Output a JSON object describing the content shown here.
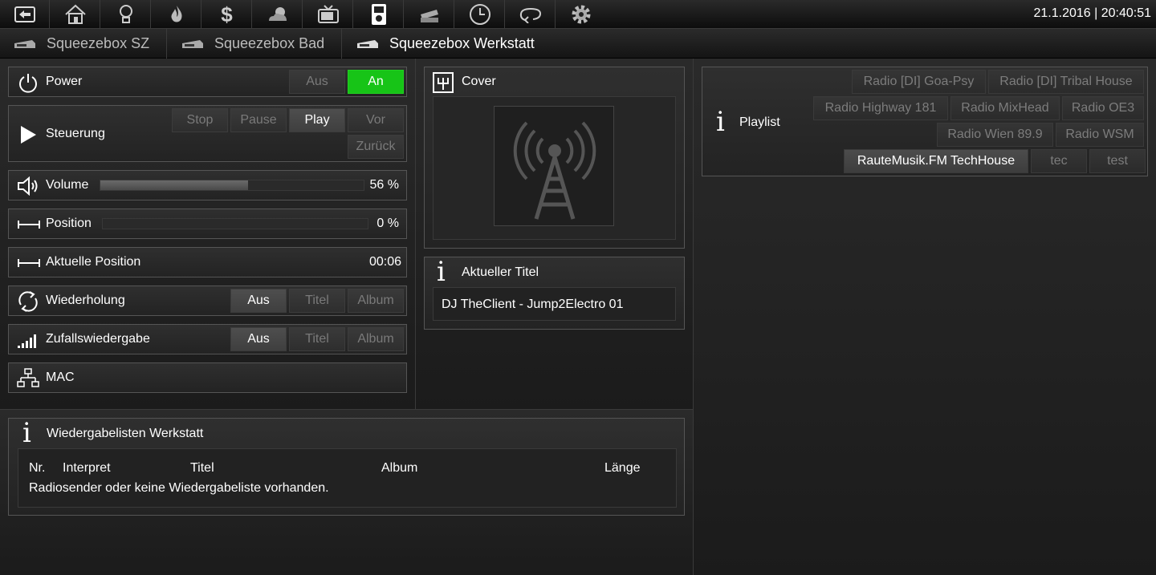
{
  "header": {
    "datetime": "21.1.2016 | 20:40:51",
    "nav_icons": [
      "back-icon",
      "home-icon",
      "bulb-icon",
      "flame-icon",
      "dollar-icon",
      "weather-icon",
      "tv-icon",
      "media-player-icon",
      "scanner-icon",
      "clock-icon",
      "loop-icon",
      "gear-icon"
    ]
  },
  "tabs": [
    "Squeezebox SZ",
    "Squeezebox Bad",
    "Squeezebox Werkstatt"
  ],
  "controls": {
    "power": {
      "label": "Power",
      "off": "Aus",
      "on": "An"
    },
    "steuerung": {
      "label": "Steuerung",
      "stop": "Stop",
      "pause": "Pause",
      "play": "Play",
      "next": "Vor",
      "back": "Zurück"
    },
    "volume": {
      "label": "Volume",
      "value": "56 %",
      "level": 0.56
    },
    "position": {
      "label": "Position",
      "value": "0 %",
      "level": 0
    },
    "current_position": {
      "label": "Aktuelle Position",
      "value": "00:06"
    },
    "repeat": {
      "label": "Wiederholung",
      "off": "Aus",
      "title": "Titel",
      "album": "Album"
    },
    "shuffle": {
      "label": "Zufallswiedergabe",
      "off": "Aus",
      "title": "Titel",
      "album": "Album"
    },
    "mac": {
      "label": "MAC"
    }
  },
  "cover": {
    "label": "Cover"
  },
  "current_title": {
    "label": "Aktueller Titel",
    "value": "DJ TheClient - Jump2Electro 01"
  },
  "playlists_panel": {
    "label": "Wiedergabelisten Werkstatt",
    "columns": [
      "Nr.",
      "Interpret",
      "Titel",
      "Album",
      "Länge"
    ],
    "message": "Radiosender oder keine Wiedergabeliste vorhanden."
  },
  "playlist": {
    "label": "Playlist",
    "items": [
      "Radio [DI] Goa-Psy",
      "Radio [DI] Tribal House",
      "Radio Highway 181",
      "Radio MixHead",
      "Radio OE3",
      "Radio Wien 89.9",
      "Radio WSM",
      "RauteMusik.FM TechHouse",
      "tec",
      "test"
    ],
    "selected": "RauteMusik.FM TechHouse"
  },
  "colors": {
    "accent_on": "#17c417",
    "background": "#1c1c1c"
  }
}
